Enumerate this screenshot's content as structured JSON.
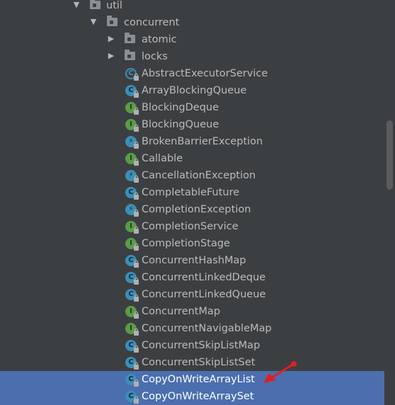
{
  "tree": {
    "packages": [
      {
        "label": "util",
        "expanded": true
      },
      {
        "label": "concurrent",
        "expanded": true
      },
      {
        "label": "atomic",
        "expanded": false
      },
      {
        "label": "locks",
        "expanded": false
      }
    ],
    "classes": [
      {
        "label": "AbstractExecutorService",
        "icon": "abstract-class-icon"
      },
      {
        "label": "ArrayBlockingQueue",
        "icon": "class-icon"
      },
      {
        "label": "BlockingDeque",
        "icon": "interface-icon"
      },
      {
        "label": "BlockingQueue",
        "icon": "interface-icon"
      },
      {
        "label": "BrokenBarrierException",
        "icon": "exception-icon"
      },
      {
        "label": "Callable",
        "icon": "interface-icon"
      },
      {
        "label": "CancellationException",
        "icon": "exception-icon"
      },
      {
        "label": "CompletableFuture",
        "icon": "class-icon"
      },
      {
        "label": "CompletionException",
        "icon": "exception-icon"
      },
      {
        "label": "CompletionService",
        "icon": "interface-icon"
      },
      {
        "label": "CompletionStage",
        "icon": "interface-icon"
      },
      {
        "label": "ConcurrentHashMap",
        "icon": "class-icon"
      },
      {
        "label": "ConcurrentLinkedDeque",
        "icon": "class-icon"
      },
      {
        "label": "ConcurrentLinkedQueue",
        "icon": "class-icon"
      },
      {
        "label": "ConcurrentMap",
        "icon": "interface-icon"
      },
      {
        "label": "ConcurrentNavigableMap",
        "icon": "interface-icon"
      },
      {
        "label": "ConcurrentSkipListMap",
        "icon": "class-icon"
      },
      {
        "label": "ConcurrentSkipListSet",
        "icon": "class-icon"
      },
      {
        "label": "CopyOnWriteArrayList",
        "icon": "class-icon",
        "selected": true
      },
      {
        "label": "CopyOnWriteArraySet",
        "icon": "class-icon",
        "selected": true
      }
    ]
  },
  "colors": {
    "background": "#3c3f41",
    "selection": "#4b6eaf",
    "text": "#bbbbbb",
    "class_icon": "#3c8fb5",
    "interface_icon": "#5b9b48",
    "annotation_arrow": "#e02020"
  }
}
